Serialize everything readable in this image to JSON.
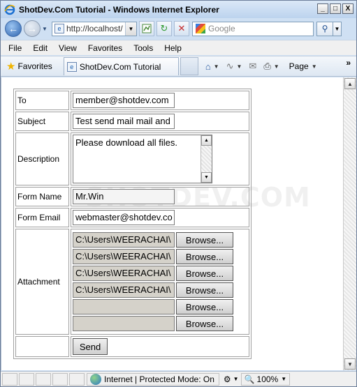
{
  "window": {
    "title": "ShotDev.Com Tutorial - Windows Internet Explorer",
    "controls": [
      "_",
      "□",
      "X"
    ]
  },
  "address": {
    "url": "http://localhost/",
    "search_placeholder": "Google"
  },
  "menu": [
    "File",
    "Edit",
    "View",
    "Favorites",
    "Tools",
    "Help"
  ],
  "favbar": {
    "favorites_label": "Favorites",
    "tab_title": "ShotDev.Com Tutorial",
    "page_label": "Page",
    "chevron": "»"
  },
  "watermark": "SHOTDEV.COM",
  "form": {
    "to_label": "To",
    "to_value": "member@shotdev.com",
    "subject_label": "Subject",
    "subject_value": "Test send mail mail and",
    "description_label": "Description",
    "description_value": "Please download all files.",
    "from_name_label": "Form Name",
    "from_name_value": "Mr.Win",
    "from_email_label": "Form Email",
    "from_email_value": "webmaster@shotdev.co",
    "attachment_label": "Attachment",
    "attachments": [
      {
        "path": "C:\\Users\\WEERACHAI\\",
        "browse": "Browse..."
      },
      {
        "path": "C:\\Users\\WEERACHAI\\",
        "browse": "Browse..."
      },
      {
        "path": "C:\\Users\\WEERACHAI\\",
        "browse": "Browse..."
      },
      {
        "path": "C:\\Users\\WEERACHAI\\",
        "browse": "Browse..."
      },
      {
        "path": "",
        "browse": "Browse..."
      },
      {
        "path": "",
        "browse": "Browse..."
      }
    ],
    "send_label": "Send"
  },
  "status": {
    "zone": "Internet | Protected Mode: On",
    "zoom": "100%"
  }
}
